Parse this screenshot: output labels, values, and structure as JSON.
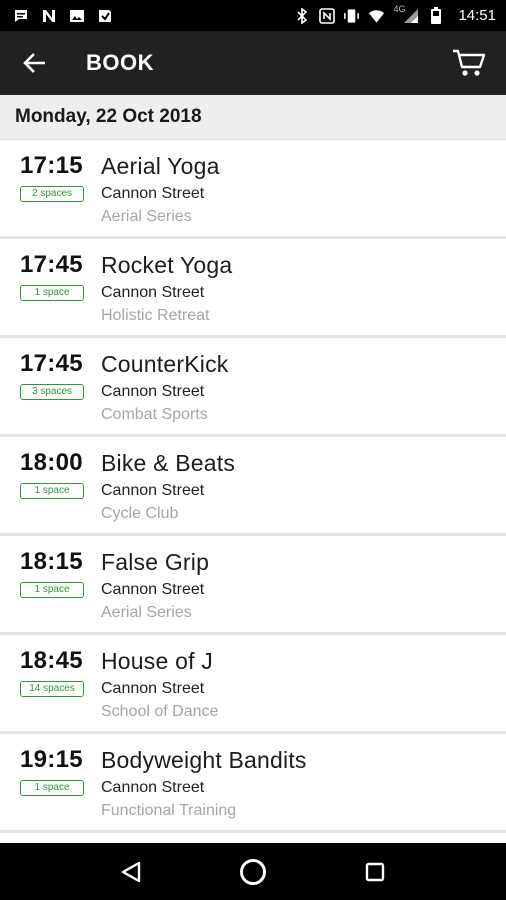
{
  "status_bar": {
    "time": "14:51",
    "network": "4G",
    "icons_left": [
      "chat-notification-icon",
      "n-app-icon",
      "image-icon",
      "download-icon"
    ],
    "icons_right": [
      "bluetooth-icon",
      "nfc-icon",
      "vibrate-icon",
      "wifi-icon",
      "signal-icon",
      "battery-icon"
    ]
  },
  "app_bar": {
    "title": "BOOK",
    "back_icon": "arrow-left-icon",
    "cart_icon": "cart-icon"
  },
  "schedule": {
    "date": "Monday, 22 Oct 2018",
    "classes": [
      {
        "time": "17:15",
        "spaces": "2 spaces",
        "name": "Aerial Yoga",
        "location": "Cannon Street",
        "series": "Aerial Series"
      },
      {
        "time": "17:45",
        "spaces": "1 space",
        "name": "Rocket Yoga",
        "location": "Cannon Street",
        "series": "Holistic Retreat"
      },
      {
        "time": "17:45",
        "spaces": "3 spaces",
        "name": "CounterKick",
        "location": "Cannon Street",
        "series": "Combat Sports"
      },
      {
        "time": "18:00",
        "spaces": "1 space",
        "name": "Bike & Beats",
        "location": "Cannon Street",
        "series": "Cycle Club"
      },
      {
        "time": "18:15",
        "spaces": "1 space",
        "name": "False Grip",
        "location": "Cannon Street",
        "series": "Aerial Series"
      },
      {
        "time": "18:45",
        "spaces": "14 spaces",
        "name": "House of J",
        "location": "Cannon Street",
        "series": "School of Dance"
      },
      {
        "time": "19:15",
        "spaces": "1 space",
        "name": "Bodyweight Bandits",
        "location": "Cannon Street",
        "series": "Functional Training"
      }
    ]
  },
  "colors": {
    "app_bar": "#222222",
    "badge_green": "#2e9a34",
    "date_header_bg": "#eeeeee"
  },
  "nav_bar": {
    "icons": [
      "back-triangle-icon",
      "home-circle-icon",
      "recents-square-icon"
    ]
  }
}
